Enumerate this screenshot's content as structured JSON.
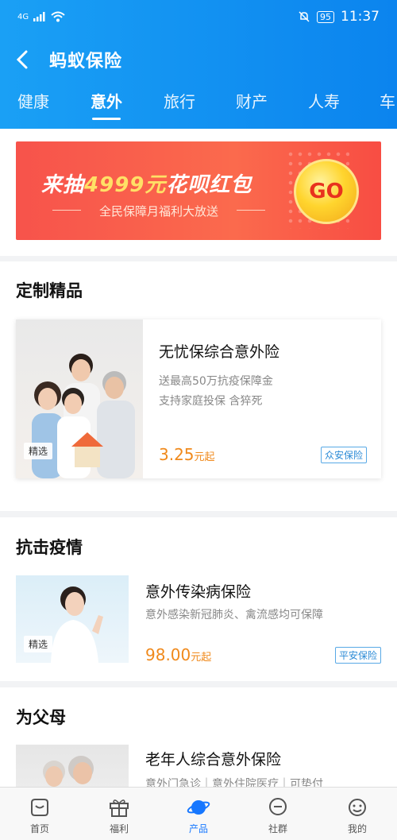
{
  "status": {
    "network": "4G",
    "battery": "95",
    "time": "11:37"
  },
  "nav": {
    "back_label": "返回",
    "title": "蚂蚁保险"
  },
  "tabs": [
    {
      "label": "健康",
      "active": false
    },
    {
      "label": "意外",
      "active": true
    },
    {
      "label": "旅行",
      "active": false
    },
    {
      "label": "财产",
      "active": false
    },
    {
      "label": "人寿",
      "active": false
    },
    {
      "label": "车",
      "active": false
    }
  ],
  "banner": {
    "text_before": "来抽",
    "highlight": "4999元",
    "text_after": "花呗红包",
    "subtitle": "全民保障月福利大放送",
    "go_label": "GO"
  },
  "sections": {
    "custom": {
      "title": "定制精品"
    },
    "epidemic": {
      "title": "抗击疫情"
    },
    "parents": {
      "title": "为父母"
    }
  },
  "products": {
    "p1": {
      "badge": "精选",
      "title": "无忧保综合意外险",
      "desc1": "送最高50万抗疫保障金",
      "desc2": "支持家庭投保 含猝死",
      "price": "3.25",
      "price_unit": "元起",
      "tag": "众安保险"
    },
    "p2": {
      "badge": "精选",
      "title": "意外传染病保险",
      "desc1": "意外感染新冠肺炎、禽流感均可保障",
      "price": "98.00",
      "price_unit": "元起",
      "tag": "平安保险"
    },
    "p3": {
      "title": "老年人综合意外保险",
      "desc1": "意外门急诊｜意外住院医疗｜可垫付"
    }
  },
  "tabbar": [
    {
      "label": "首页",
      "icon": "home-icon",
      "active": false
    },
    {
      "label": "福利",
      "icon": "gift-icon",
      "active": false
    },
    {
      "label": "产品",
      "icon": "planet-icon",
      "active": true
    },
    {
      "label": "社群",
      "icon": "chat-icon",
      "active": false
    },
    {
      "label": "我的",
      "icon": "profile-icon",
      "active": false
    }
  ],
  "colors": {
    "header": "#1aa0f5",
    "accent": "#1677ff",
    "price": "#f0891b",
    "banner": "#f7534b"
  }
}
